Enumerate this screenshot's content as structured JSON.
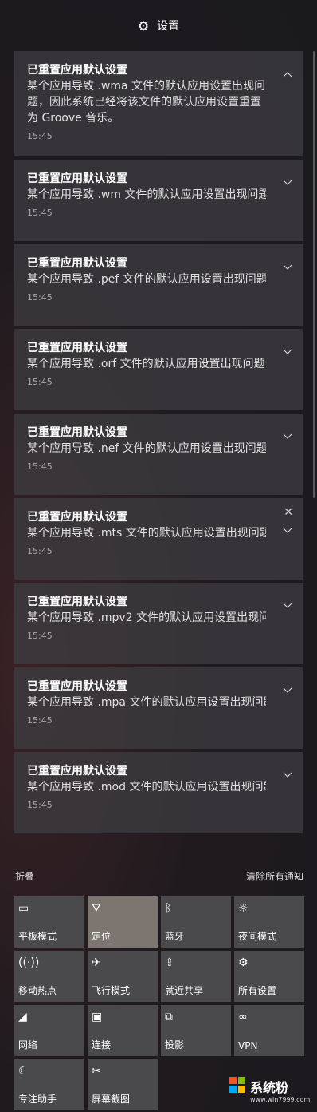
{
  "header": {
    "title": "设置",
    "icon": "gear-icon"
  },
  "notifications": [
    {
      "title": "已重置应用默认设置",
      "body": "某个应用导致 .wma 文件的默认应用设置出现问题，因此系统已经将该文件的默认应用设置重置为 Groove 音乐。",
      "time": "15:45",
      "expanded": true
    },
    {
      "title": "已重置应用默认设置",
      "body": "某个应用导致 .wm 文件的默认应用设置出现问题",
      "time": "15:45",
      "expanded": false
    },
    {
      "title": "已重置应用默认设置",
      "body": "某个应用导致 .pef 文件的默认应用设置出现问题",
      "time": "15:45",
      "expanded": false
    },
    {
      "title": "已重置应用默认设置",
      "body": "某个应用导致 .orf 文件的默认应用设置出现问题",
      "time": "15:45",
      "expanded": false
    },
    {
      "title": "已重置应用默认设置",
      "body": "某个应用导致 .nef 文件的默认应用设置出现问题",
      "time": "15:45",
      "expanded": false
    },
    {
      "title": "已重置应用默认设置",
      "body": "某个应用导致 .mts 文件的默认应用设置出现问题",
      "time": "15:45",
      "expanded": false,
      "hovered": true
    },
    {
      "title": "已重置应用默认设置",
      "body": "某个应用导致 .mpv2 文件的默认应用设置出现问题",
      "time": "15:45",
      "expanded": false
    },
    {
      "title": "已重置应用默认设置",
      "body": "某个应用导致 .mpa 文件的默认应用设置出现问题",
      "time": "15:45",
      "expanded": false
    },
    {
      "title": "已重置应用默认设置",
      "body": "某个应用导致 .mod 文件的默认应用设置出现问题",
      "time": "15:45",
      "expanded": false
    }
  ],
  "actions": {
    "collapse_label": "折叠",
    "clear_label": "清除所有通知"
  },
  "quick_actions": [
    {
      "label": "平板模式",
      "icon": "tablet-mode-icon",
      "glyph": "▭",
      "active": false
    },
    {
      "label": "定位",
      "icon": "location-icon",
      "glyph": "⛛",
      "active": true
    },
    {
      "label": "蓝牙",
      "icon": "bluetooth-icon",
      "glyph": "ᛒ",
      "active": false
    },
    {
      "label": "夜间模式",
      "icon": "brightness-icon",
      "glyph": "☼",
      "active": false
    },
    {
      "label": "移动热点",
      "icon": "hotspot-icon",
      "glyph": "((·))",
      "active": false
    },
    {
      "label": "飞行模式",
      "icon": "airplane-icon",
      "glyph": "✈",
      "active": false
    },
    {
      "label": "就近共享",
      "icon": "share-icon",
      "glyph": "⇪",
      "active": false
    },
    {
      "label": "所有设置",
      "icon": "settings-icon",
      "glyph": "⚙",
      "active": false
    },
    {
      "label": "网络",
      "icon": "network-icon",
      "glyph": "◢",
      "active": false
    },
    {
      "label": "连接",
      "icon": "connect-icon",
      "glyph": "▣",
      "active": false
    },
    {
      "label": "投影",
      "icon": "project-icon",
      "glyph": "⧉",
      "active": false
    },
    {
      "label": "VPN",
      "icon": "vpn-icon",
      "glyph": "∞",
      "active": false
    },
    {
      "label": "专注助手",
      "icon": "moon-icon",
      "glyph": "☾",
      "active": false
    },
    {
      "label": "屏幕截图",
      "icon": "snip-icon",
      "glyph": "✂",
      "active": false
    }
  ],
  "watermark": {
    "text": "系统粉",
    "url": "www.win7999.com"
  }
}
